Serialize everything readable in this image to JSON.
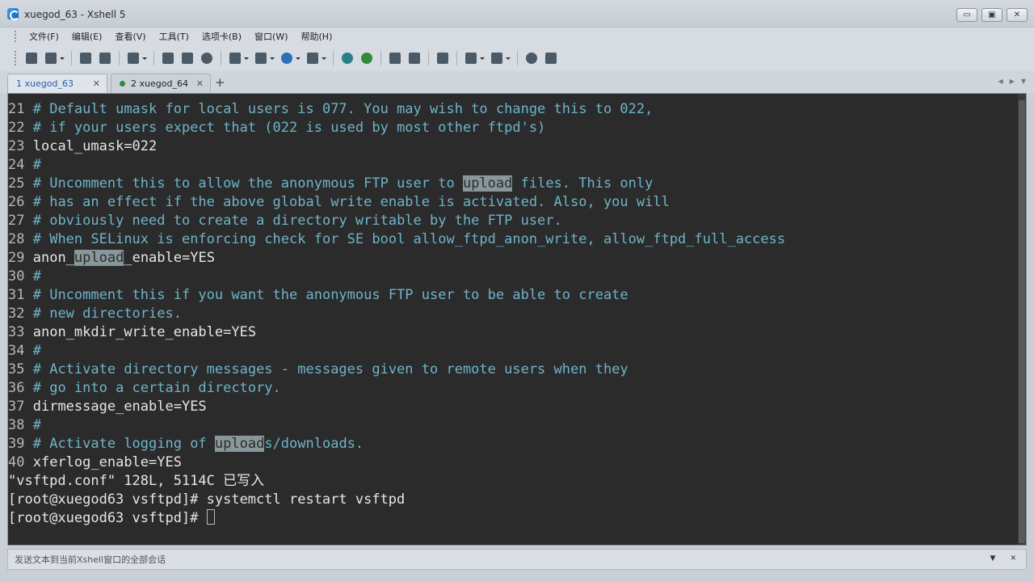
{
  "window": {
    "title": "xuegod_63 - Xshell 5"
  },
  "window_buttons": {
    "minimize": "▭",
    "restore": "▣",
    "close": "✕"
  },
  "menu": [
    {
      "label": "文件(F)"
    },
    {
      "label": "编辑(E)"
    },
    {
      "label": "查看(V)"
    },
    {
      "label": "工具(T)"
    },
    {
      "label": "选项卡(B)"
    },
    {
      "label": "窗口(W)"
    },
    {
      "label": "帮助(H)"
    }
  ],
  "tabs": [
    {
      "label": "1 xuegod_63",
      "active": true,
      "close": "✕"
    },
    {
      "label": "2 xuegod_64",
      "active": false,
      "close": "✕"
    }
  ],
  "tab_add": "+",
  "terminal": {
    "lines": [
      {
        "num": "21",
        "text": "# Default umask for local users is 077. You may wish to change this to 022,"
      },
      {
        "num": "22",
        "text": "# if your users expect that (022 is used by most other ftpd's)"
      },
      {
        "num": "23",
        "text": "local_umask=022"
      },
      {
        "num": "24",
        "text": "#"
      },
      {
        "num": "25",
        "pre": "# Uncomment this to allow the anonymous FTP user to ",
        "hl": "upload",
        "post": " files. This only"
      },
      {
        "num": "26",
        "text": "# has an effect if the above global write enable is activated. Also, you will"
      },
      {
        "num": "27",
        "text": "# obviously need to create a directory writable by the FTP user."
      },
      {
        "num": "28",
        "text": "# When SELinux is enforcing check for SE bool allow_ftpd_anon_write, allow_ftpd_full_access"
      },
      {
        "num": "29",
        "pre": "anon_",
        "hl": "upload",
        "post": "_enable=YES"
      },
      {
        "num": "30",
        "text": "#"
      },
      {
        "num": "31",
        "text": "# Uncomment this if you want the anonymous FTP user to be able to create"
      },
      {
        "num": "32",
        "text": "# new directories."
      },
      {
        "num": "33",
        "text": "anon_mkdir_write_enable=YES"
      },
      {
        "num": "34",
        "text": "#"
      },
      {
        "num": "35",
        "text": "# Activate directory messages - messages given to remote users when they"
      },
      {
        "num": "36",
        "text": "# go into a certain directory."
      },
      {
        "num": "37",
        "text": "dirmessage_enable=YES"
      },
      {
        "num": "38",
        "text": "#"
      },
      {
        "num": "39",
        "pre": "# Activate logging of ",
        "hl": "upload",
        "post": "s/downloads."
      },
      {
        "num": "40",
        "text": "xferlog_enable=YES"
      }
    ],
    "status_line": "\"vsftpd.conf\" 128L, 5114C 已写入",
    "prompt1": "[root@xuegod63 vsftpd]# systemctl restart vsftpd",
    "prompt2": "[root@xuegod63 vsftpd]# "
  },
  "compose_bar": {
    "placeholder": "发送文本到当前Xshell窗口的全部会话"
  },
  "colors": {
    "terminal_bg": "#2b2b2b",
    "comment": "#6eb4c8",
    "highlight": "#88989a"
  }
}
